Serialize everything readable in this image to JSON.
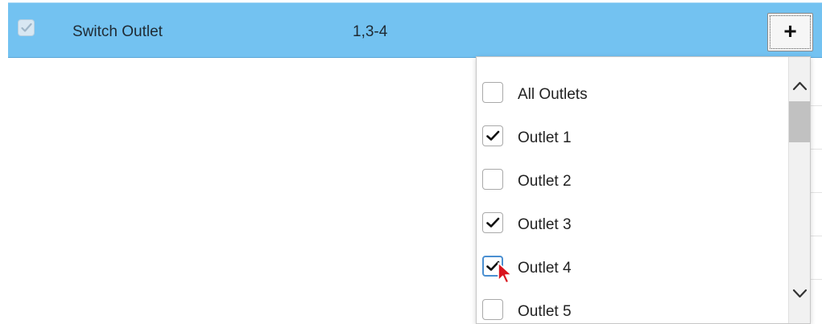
{
  "row": {
    "name": "Switch Outlet",
    "value": "1,3-4",
    "checked": true,
    "add_label": "+"
  },
  "dropdown": {
    "options": [
      {
        "label": "All Outlets",
        "checked": false
      },
      {
        "label": "Outlet 1",
        "checked": true
      },
      {
        "label": "Outlet 2",
        "checked": false
      },
      {
        "label": "Outlet 3",
        "checked": true
      },
      {
        "label": "Outlet 4",
        "checked": true,
        "focused": true
      },
      {
        "label": "Outlet 5",
        "checked": false
      }
    ]
  },
  "icons": {
    "checkmark": "checkmark-icon",
    "scroll_up": "chevron-up-icon",
    "scroll_down": "chevron-down-icon",
    "cursor": "mouse-pointer-icon"
  },
  "colors": {
    "row_selected": "#73c2f1",
    "focus_border": "#4a8fd1",
    "cursor_red": "#d9141e"
  }
}
